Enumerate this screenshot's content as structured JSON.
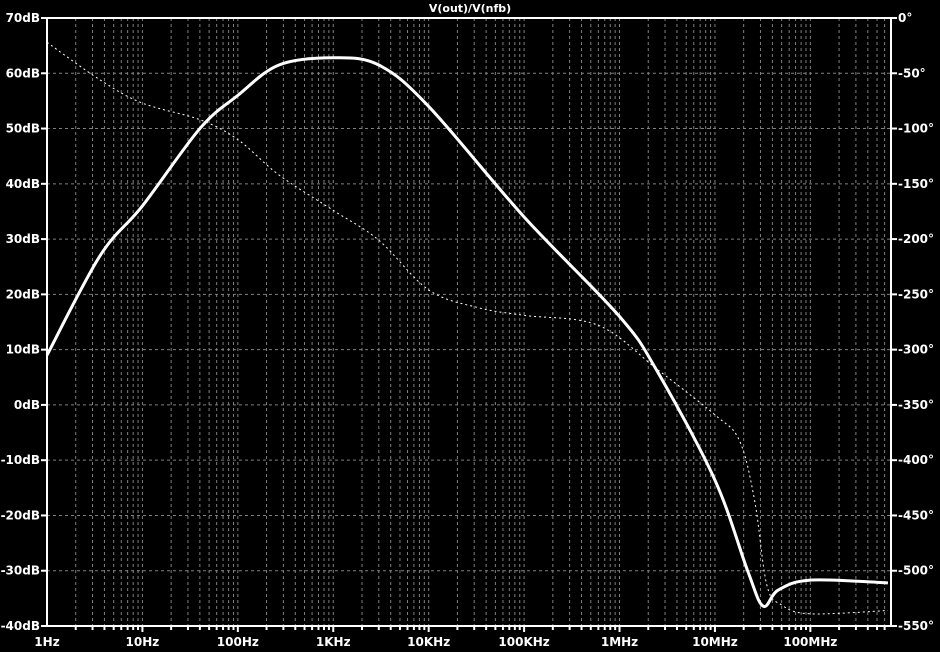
{
  "chart_data": {
    "type": "line",
    "title": "V(out)/V(nfb)",
    "xscale": "log",
    "xlim": [
      1,
      700000000
    ],
    "x_ticks": [
      {
        "value": 1,
        "label": "1Hz"
      },
      {
        "value": 10,
        "label": "10Hz"
      },
      {
        "value": 100,
        "label": "100Hz"
      },
      {
        "value": 1000,
        "label": "1KHz"
      },
      {
        "value": 10000,
        "label": "10KHz"
      },
      {
        "value": 100000,
        "label": "100KHz"
      },
      {
        "value": 1000000,
        "label": "1MHz"
      },
      {
        "value": 10000000,
        "label": "10MHz"
      },
      {
        "value": 100000000,
        "label": "100MHz"
      }
    ],
    "y_left": {
      "lim": [
        -40,
        70
      ],
      "ticks": [
        {
          "value": 70,
          "label": "70dB"
        },
        {
          "value": 60,
          "label": "60dB"
        },
        {
          "value": 50,
          "label": "50dB"
        },
        {
          "value": 40,
          "label": "40dB"
        },
        {
          "value": 30,
          "label": "30dB"
        },
        {
          "value": 20,
          "label": "20dB"
        },
        {
          "value": 10,
          "label": "10dB"
        },
        {
          "value": 0,
          "label": "0dB"
        },
        {
          "value": -10,
          "label": "-10dB"
        },
        {
          "value": -20,
          "label": "-20dB"
        },
        {
          "value": -30,
          "label": "-30dB"
        },
        {
          "value": -40,
          "label": "-40dB"
        }
      ]
    },
    "y_right": {
      "lim": [
        -550,
        0
      ],
      "ticks": [
        {
          "value": 0,
          "label": "0°"
        },
        {
          "value": -50,
          "label": "-50°"
        },
        {
          "value": -100,
          "label": "-100°"
        },
        {
          "value": -150,
          "label": "-150°"
        },
        {
          "value": -200,
          "label": "-200°"
        },
        {
          "value": -250,
          "label": "-250°"
        },
        {
          "value": -300,
          "label": "-300°"
        },
        {
          "value": -350,
          "label": "-350°"
        },
        {
          "value": -400,
          "label": "-400°"
        },
        {
          "value": -450,
          "label": "-450°"
        },
        {
          "value": -500,
          "label": "-500°"
        },
        {
          "value": -550,
          "label": "-550°"
        }
      ]
    },
    "grid": true,
    "colors": {
      "background": "#000000",
      "trace": "#ffffff",
      "grid": "#808080"
    },
    "series": [
      {
        "kind": "magnitude",
        "axis": "left",
        "style": "solid",
        "x": [
          1,
          3.6,
          10,
          40,
          100,
          270,
          1000,
          3000,
          10000,
          100000,
          1000000,
          2500000,
          10000000,
          22000000,
          32000000,
          46000000,
          100000000,
          650000000
        ],
        "y": [
          9,
          27,
          36,
          50,
          56,
          61.5,
          62.8,
          61.5,
          54,
          34,
          16,
          6,
          -13.6,
          -30,
          -36.4,
          -33.5,
          -31.7,
          -32.2
        ]
      },
      {
        "kind": "phase",
        "axis": "right",
        "style": "dashed",
        "x": [
          1,
          3.6,
          10,
          40,
          100,
          270,
          1000,
          3000,
          10000,
          33000,
          100000,
          600000,
          2500000,
          10000000,
          18000000,
          26000000,
          35000000,
          50000000,
          100000000,
          650000000
        ],
        "y": [
          -22,
          -56,
          -77,
          -92,
          -110,
          -142,
          -174,
          -201,
          -246,
          -262,
          -269,
          -278,
          -318,
          -359,
          -382,
          -436,
          -513,
          -531,
          -539,
          -536
        ]
      }
    ]
  }
}
